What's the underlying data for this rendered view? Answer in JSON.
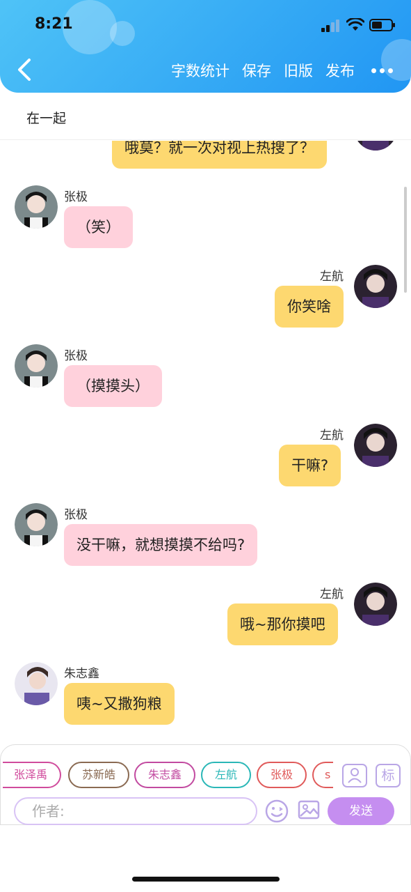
{
  "status_bar": {
    "time": "8:21"
  },
  "header": {
    "actions": [
      {
        "label": "字数统计"
      },
      {
        "label": "保存"
      },
      {
        "label": "旧版"
      },
      {
        "label": "发布"
      }
    ]
  },
  "title": "在一起",
  "messages": [
    {
      "side": "right",
      "text": "哦莫？就一次对视上热搜了？",
      "color": "yellow"
    },
    {
      "side": "left",
      "name": "张极",
      "text": "（笑）",
      "color": "pink"
    },
    {
      "side": "right",
      "name": "左航",
      "text": "你笑啥",
      "color": "yellow"
    },
    {
      "side": "left",
      "name": "张极",
      "text": "（摸摸头）",
      "color": "pink"
    },
    {
      "side": "right",
      "name": "左航",
      "text": "干嘛?",
      "color": "yellow"
    },
    {
      "side": "left",
      "name": "张极",
      "text": "没干嘛，就想摸摸不给吗?",
      "color": "pink"
    },
    {
      "side": "right",
      "name": "左航",
      "text": "哦~那你摸吧",
      "color": "yellow"
    },
    {
      "side": "left",
      "name": "朱志鑫",
      "text": "咦~又撒狗粮",
      "color": "yellow"
    }
  ],
  "composer": {
    "chips": [
      {
        "label": "张泽禹",
        "color": "#d04b9c"
      },
      {
        "label": "苏新皓",
        "color": "#8a6a52"
      },
      {
        "label": "朱志鑫",
        "color": "#c24aa0"
      },
      {
        "label": "左航",
        "color": "#2ab7b7"
      },
      {
        "label": "张极",
        "color": "#e05a5a"
      },
      {
        "label": "s",
        "color": "#e05a5a"
      }
    ],
    "tag_icon_label": "标",
    "author_placeholder": "作者:",
    "send_label": "发送"
  },
  "colors": {
    "header_gradient_start": "#4fc3f7",
    "header_gradient_end": "#2196f3",
    "bubble_pink": "#ffd1dc",
    "bubble_yellow": "#fdd870",
    "accent_purple": "#c58ef0"
  }
}
